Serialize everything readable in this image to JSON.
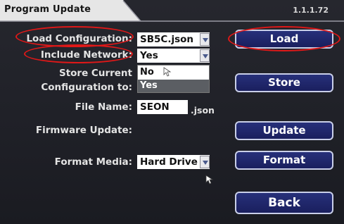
{
  "header": {
    "title": "Program Update",
    "version": "1.1.1.72"
  },
  "settings": {
    "load_configuration": {
      "label": "Load Configuration:",
      "value": "SB5C.json"
    },
    "include_network": {
      "label": "Include Network:",
      "value": "Yes",
      "options": [
        "No",
        "Yes"
      ],
      "highlighted_option": "Yes"
    },
    "store_current": {
      "label_line1": "Store Current",
      "label_line2": "Configuration to:"
    },
    "file_name": {
      "label": "File Name:",
      "value": "SEON",
      "extension": ".json"
    },
    "firmware_update": {
      "label": "Firmware Update:"
    },
    "format_media": {
      "label": "Format Media:",
      "value": "Hard Drive"
    }
  },
  "buttons": {
    "load": "Load",
    "store": "Store",
    "update": "Update",
    "format": "Format",
    "back": "Back"
  },
  "colors": {
    "background": "#1f2027",
    "tab": "#e6e6e6",
    "button_fill": "#1f2566",
    "button_border": "#c9cfe8",
    "highlight_ellipse": "#e01818",
    "selected_option": "#5b5e63"
  }
}
